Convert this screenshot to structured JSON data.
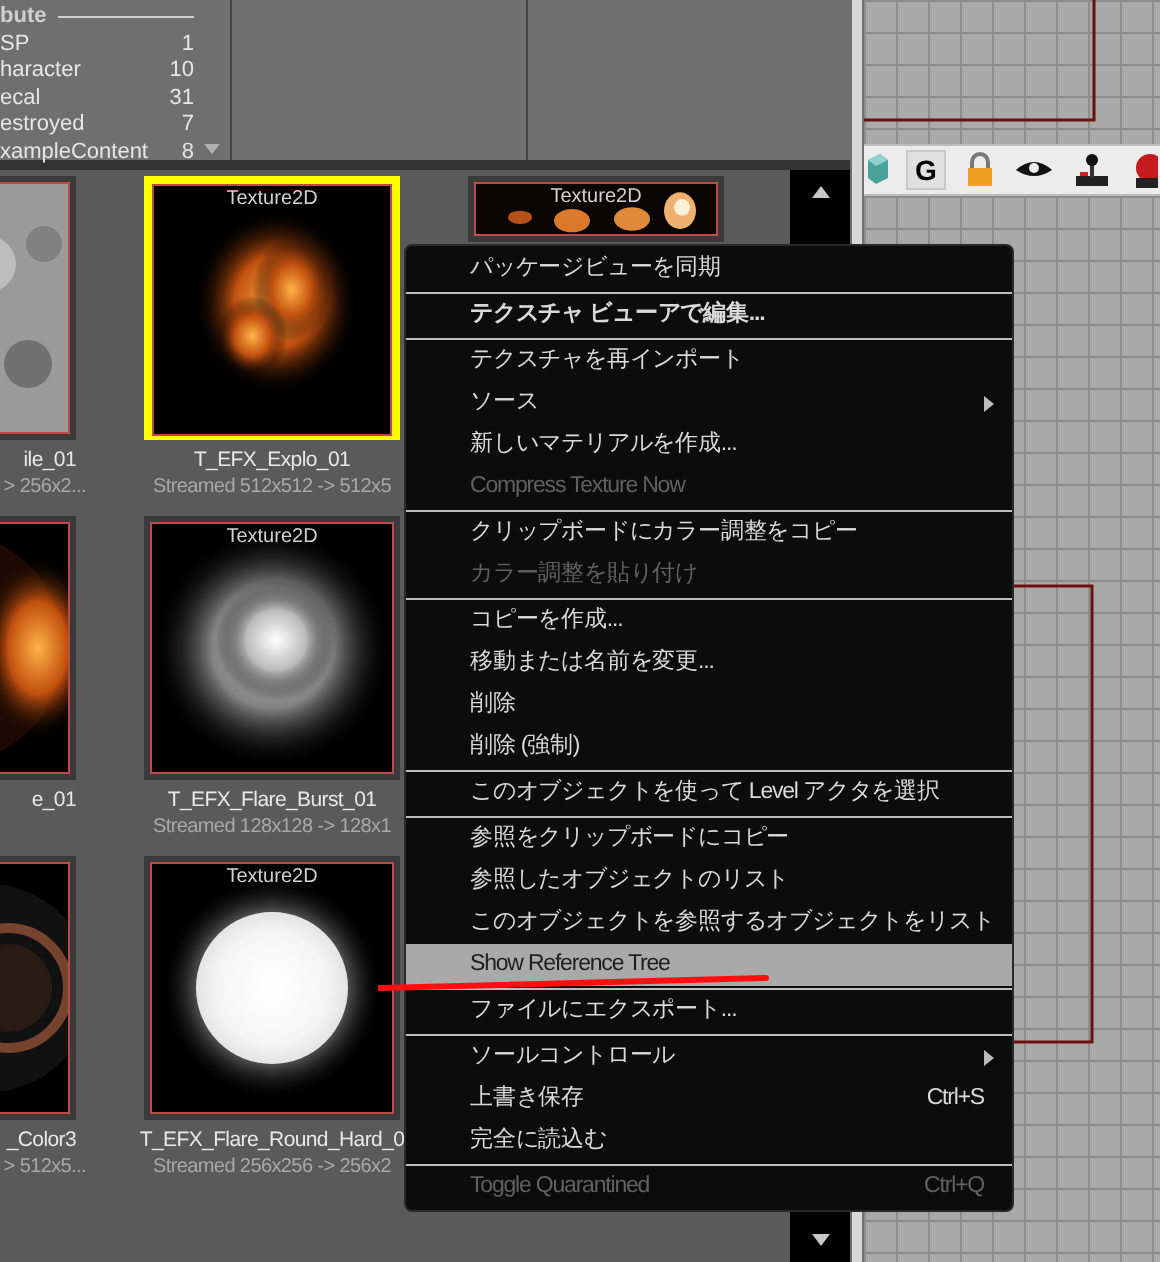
{
  "attribute_panel": {
    "heading": "bute",
    "items": [
      {
        "label": "SP",
        "count": "1"
      },
      {
        "label": "haracter",
        "count": "10"
      },
      {
        "label": "ecal",
        "count": "31"
      },
      {
        "label": "estroyed",
        "count": "7"
      },
      {
        "label": "xampleContent",
        "count": "8"
      }
    ]
  },
  "thumbnail_rows": [
    [
      {
        "name": "ile_01",
        "info": "> 256x2...",
        "selected": false
      },
      {
        "type_label": "Texture2D",
        "name": "T_EFX_Explo_01",
        "info": "Streamed 512x512 -> 512x5",
        "selected": true
      },
      {
        "type_label": "Texture2D",
        "selected": false
      }
    ],
    [
      {
        "name": "e_01",
        "selected": false
      },
      {
        "type_label": "Texture2D",
        "name": "T_EFX_Flare_Burst_01",
        "info": "Streamed 128x128 -> 128x1",
        "selected": false
      }
    ],
    [
      {
        "name": "_Color3",
        "info": "> 512x5...",
        "selected": false
      },
      {
        "type_label": "Texture2D",
        "name": "T_EFX_Flare_Round_Hard_0",
        "info": "Streamed 256x256 -> 256x2",
        "selected": false
      }
    ]
  ],
  "toolbar": [
    {
      "kind": "cube"
    },
    {
      "kind": "letter",
      "label": "G"
    },
    {
      "kind": "lock"
    },
    {
      "kind": "eye"
    },
    {
      "kind": "joystick"
    },
    {
      "kind": "figure"
    }
  ],
  "context_menu": [
    {
      "kind": "item",
      "label": "パッケージビューを同期"
    },
    {
      "kind": "separator"
    },
    {
      "kind": "item",
      "label": "テクスチャ ビューアで編集...",
      "bold": true
    },
    {
      "kind": "separator"
    },
    {
      "kind": "item",
      "label": "テクスチャを再インポート"
    },
    {
      "kind": "item",
      "label": "ソース",
      "submenu": true
    },
    {
      "kind": "item",
      "label": "新しいマテリアルを作成..."
    },
    {
      "kind": "item",
      "label": "Compress Texture Now",
      "disabled": true
    },
    {
      "kind": "separator"
    },
    {
      "kind": "item",
      "label": "クリップボードにカラー調整をコピー"
    },
    {
      "kind": "item",
      "label": "カラー調整を貼り付け",
      "disabled": true
    },
    {
      "kind": "separator"
    },
    {
      "kind": "item",
      "label": "コピーを作成..."
    },
    {
      "kind": "item",
      "label": "移動または名前を変更..."
    },
    {
      "kind": "item",
      "label": "削除"
    },
    {
      "kind": "item",
      "label": "削除 (強制)"
    },
    {
      "kind": "separator"
    },
    {
      "kind": "item",
      "label": "このオブジェクトを使って Level アクタを選択"
    },
    {
      "kind": "separator"
    },
    {
      "kind": "item",
      "label": "参照をクリップボードにコピー"
    },
    {
      "kind": "item",
      "label": "参照したオブジェクトのリスト"
    },
    {
      "kind": "item",
      "label": "このオブジェクトを参照するオブジェクトをリスト"
    },
    {
      "kind": "item",
      "label": "Show Reference Tree",
      "selected": true
    },
    {
      "kind": "separator"
    },
    {
      "kind": "item",
      "label": "ファイルにエクスポート..."
    },
    {
      "kind": "separator"
    },
    {
      "kind": "item",
      "label": "ソールコントロール",
      "submenu": true
    },
    {
      "kind": "item",
      "label": "上書き保存",
      "shortcut": "Ctrl+S"
    },
    {
      "kind": "item",
      "label": "完全に読込む"
    },
    {
      "kind": "separator"
    },
    {
      "kind": "item",
      "label": "Toggle Quarantined",
      "disabled": true,
      "shortcut": "Ctrl+Q"
    }
  ]
}
